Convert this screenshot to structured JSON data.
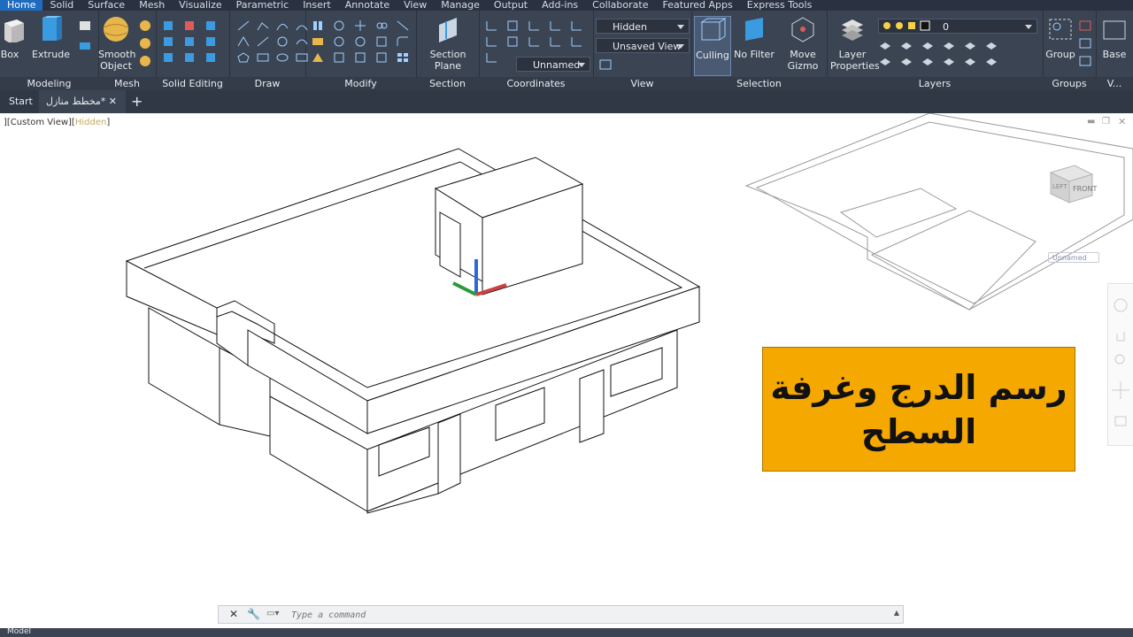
{
  "menu": [
    "Home",
    "Solid",
    "Surface",
    "Mesh",
    "Visualize",
    "Parametric",
    "Insert",
    "Annotate",
    "View",
    "Manage",
    "Output",
    "Add-ins",
    "Collaborate",
    "Featured Apps",
    "Express Tools"
  ],
  "ribbon": {
    "box_label": "Box",
    "extrude_label": "Extrude",
    "smooth_label": "Smooth\nObject",
    "section_plane_label": "Section\nPlane",
    "visual_style": "Hidden",
    "view_name": "Unsaved View",
    "ucs_name": "Unnamed",
    "culling_label": "Culling",
    "no_filter_label": "No Filter",
    "move_gizmo_label": "Move\nGizmo",
    "layer_props_label": "Layer\nProperties",
    "layer_value": "0",
    "group_label": "Group",
    "base_label": "Base",
    "panels": [
      "Modeling",
      "Mesh",
      "Solid Editing",
      "Draw",
      "Modify",
      "Section",
      "Coordinates",
      "View",
      "Selection",
      "Layers",
      "Groups",
      "V..."
    ]
  },
  "tabs": {
    "start": "Start",
    "drawing": "مخطط منازل*"
  },
  "viewport": {
    "prefix": "][Custom View][",
    "style": "Hidden",
    "suffix": "]",
    "viewcube_face": "FRONT",
    "viewcube_left": "LEFT",
    "ucs_menu": "Unnamed"
  },
  "overlay": {
    "line1": "رسم الدرج وغرفة",
    "line2": "السطح"
  },
  "command": {
    "placeholder": "Type a command"
  },
  "status": {
    "model": "Model"
  },
  "colors": {
    "accent": "#f5a800",
    "ribbon": "#3b4453",
    "menubar": "#2a3140"
  }
}
